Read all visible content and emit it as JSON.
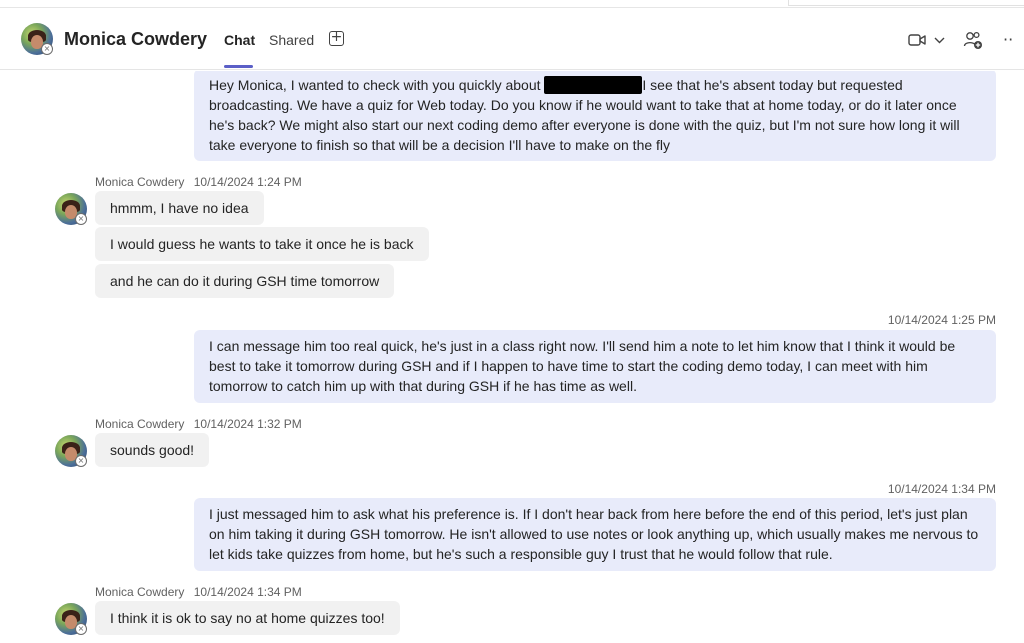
{
  "header": {
    "contact_name": "Monica Cowdery",
    "tabs": [
      {
        "label": "Chat"
      },
      {
        "label": "Shared"
      }
    ],
    "add_tab_glyph": "+",
    "more_glyph": "··",
    "icons": [
      "avatar",
      "video-call-icon",
      "chevron-down-icon",
      "add-people-icon",
      "more-options-icon"
    ],
    "accent_color": "#5b5fc7"
  },
  "messages": [
    {
      "direction": "out",
      "text_before": "Hey Monica, I wanted to check with you quickly about",
      "redacted": true,
      "text_after": "I see that he's absent today but requested broadcasting. We have a quiz for Web today. Do you know if he would want to take that at home today, or do it later once he's back? We might also start our next coding demo after everyone is done with the quiz, but I'm not sure how long it will take everyone to finish so that will be a decision I'll have to make on the fly"
    },
    {
      "direction": "in",
      "sender": "Monica Cowdery",
      "timestamp": "10/14/2024 1:24 PM",
      "lines": [
        "hmmm, I have no idea",
        "I would guess he wants to take it once he is back",
        "and he can do it during GSH time tomorrow"
      ]
    },
    {
      "direction": "out",
      "timestamp": "10/14/2024 1:25 PM",
      "text": "I can message him too real quick, he's just in a class right now. I'll send him a note to let him know that I think it would be best to take it tomorrow during GSH and if I happen to have time to start the coding demo today, I can meet with him tomorrow to catch him up with that during GSH if he has time as well."
    },
    {
      "direction": "in",
      "sender": "Monica Cowdery",
      "timestamp": "10/14/2024 1:32 PM",
      "lines": [
        "sounds good!"
      ]
    },
    {
      "direction": "out",
      "timestamp": "10/14/2024 1:34 PM",
      "text": "I just messaged him to ask what his preference is. If I don't hear back from here before the end of this period, let's just plan on him taking it during GSH tomorrow. He isn't allowed to use notes or look anything up, which usually makes me nervous to let kids take quizzes from home, but he's such a responsible guy I trust that he would follow that rule."
    },
    {
      "direction": "in",
      "sender": "Monica Cowdery",
      "timestamp": "10/14/2024 1:34 PM",
      "lines": [
        "I think it is ok to say no at home quizzes too!"
      ]
    }
  ],
  "status_glyph": "×",
  "colors": {
    "outgoing_bubble": "#e8ebfa",
    "incoming_bubble": "#f1f1f1",
    "meta_text": "#616161"
  }
}
